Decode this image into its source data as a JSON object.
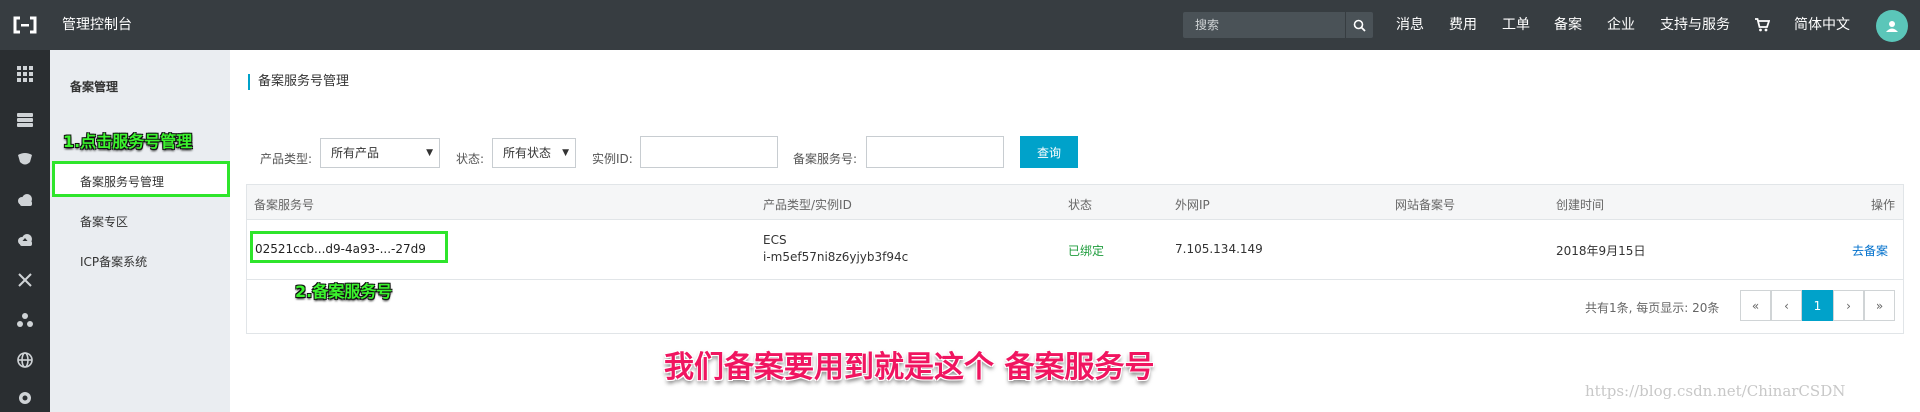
{
  "header": {
    "title": "管理控制台",
    "search_placeholder": "搜索",
    "nav": [
      "消息",
      "费用",
      "工单",
      "备案",
      "企业",
      "支持与服务"
    ],
    "language": "简体中文"
  },
  "sidebar": {
    "title": "备案管理",
    "items": [
      "备案服务号管理",
      "备案专区",
      "ICP备案系统"
    ]
  },
  "main": {
    "page_title": "备案服务号管理",
    "filters": {
      "product_type_label": "产品类型:",
      "product_type_value": "所有产品",
      "status_label": "状态:",
      "status_value": "所有状态",
      "instance_id_label": "实例ID:",
      "service_no_label": "备案服务号:",
      "query_button": "查询"
    },
    "table": {
      "columns": [
        "备案服务号",
        "产品类型/实例ID",
        "状态",
        "外网IP",
        "网站备案号",
        "创建时间",
        "操作"
      ],
      "rows": [
        {
          "service_no": "02521ccb...d9-4a93-...-27d9",
          "product_type": "ECS",
          "instance_id": "i-m5ef57ni8z6yjyb3f94c",
          "status": "已绑定",
          "ip": "7.105.134.149",
          "website_no": "",
          "created": "2018年9月15日",
          "action": "去备案"
        }
      ]
    },
    "pagination": {
      "info": "共有1条, 每页显示: 20条",
      "first": "«",
      "prev": "‹",
      "current": "1",
      "next": "›",
      "last": "»"
    }
  },
  "annotations": {
    "step1": "1.点击服务号管理",
    "step2": "2.备案服务号",
    "caption": "我们备案要用到就是这个 备案服务号",
    "watermark": "https://blog.csdn.net/ChinarCSDN"
  },
  "colors": {
    "topbar": "#373d41",
    "accent": "#00a2ca",
    "highlight": "#2ee52b",
    "caption": "#f01560"
  }
}
